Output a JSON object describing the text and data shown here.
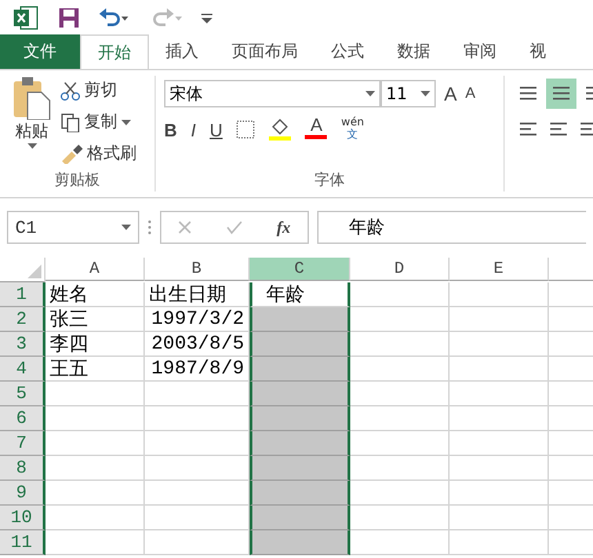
{
  "tabs": [
    {
      "label": "文件",
      "kind": "file",
      "selected": false
    },
    {
      "label": "开始",
      "kind": "tab",
      "selected": true
    },
    {
      "label": "插入",
      "kind": "tab",
      "selected": false
    },
    {
      "label": "页面布局",
      "kind": "tab",
      "selected": false
    },
    {
      "label": "公式",
      "kind": "tab",
      "selected": false
    },
    {
      "label": "数据",
      "kind": "tab",
      "selected": false
    },
    {
      "label": "审阅",
      "kind": "tab",
      "selected": false
    },
    {
      "label": "视",
      "kind": "tab",
      "selected": false
    }
  ],
  "clipboard": {
    "paste": "粘贴",
    "cut": "剪切",
    "copy": "复制",
    "format_painter": "格式刷",
    "group_label": "剪贴板"
  },
  "font": {
    "name": "宋体",
    "size": "11",
    "grow": "A",
    "shrink": "A",
    "bold": "B",
    "italic": "I",
    "underline": "U",
    "font_color": "A",
    "phonetic_top": "wén",
    "phonetic_bottom": "文",
    "group_label": "字体"
  },
  "alignment": [
    {
      "selected": false
    },
    {
      "selected": true
    },
    {
      "selected": false
    }
  ],
  "name_box": "C1",
  "function_label": "fx",
  "formula": "年龄",
  "columns": [
    {
      "label": "A",
      "selected": false
    },
    {
      "label": "B",
      "selected": false
    },
    {
      "label": "C",
      "selected": true
    },
    {
      "label": "D",
      "selected": false
    },
    {
      "label": "E",
      "selected": false
    }
  ],
  "rows": [
    {
      "number": "1",
      "active": true,
      "cells": {
        "A": "姓名",
        "B": "出生日期",
        "C": "年龄"
      }
    },
    {
      "number": "2",
      "active": false,
      "cells": {
        "A": "张三",
        "B": "1997/3/2"
      }
    },
    {
      "number": "3",
      "active": false,
      "cells": {
        "A": "李四",
        "B": "2003/8/5"
      }
    },
    {
      "number": "4",
      "active": false,
      "cells": {
        "A": "王五",
        "B": "1987/8/9"
      }
    },
    {
      "number": "5",
      "active": false,
      "cells": {}
    },
    {
      "number": "6",
      "active": false,
      "cells": {}
    },
    {
      "number": "7",
      "active": false,
      "cells": {}
    },
    {
      "number": "8",
      "active": false,
      "cells": {}
    },
    {
      "number": "9",
      "active": false,
      "cells": {}
    },
    {
      "number": "10",
      "active": false,
      "cells": {}
    },
    {
      "number": "11",
      "active": false,
      "cells": {}
    }
  ]
}
